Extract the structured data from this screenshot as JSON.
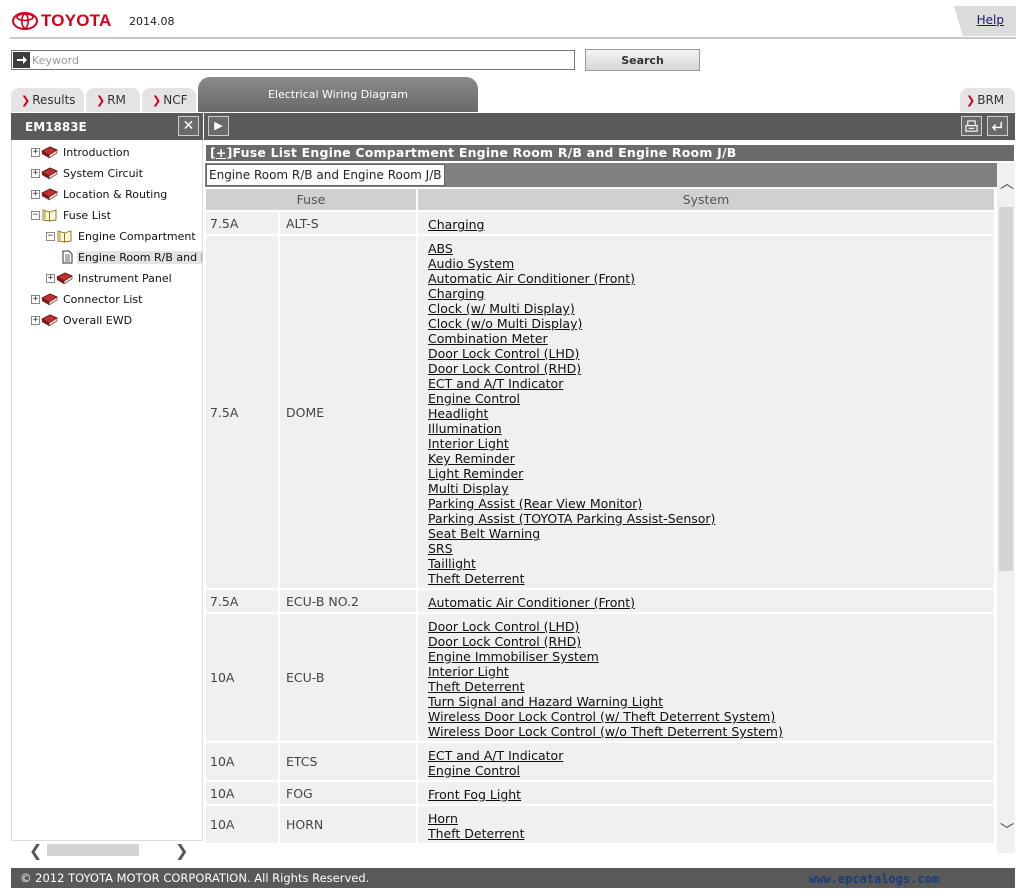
{
  "header": {
    "brand": "TOYOTA",
    "version": "2014.08",
    "help_label": "Help"
  },
  "search": {
    "placeholder": "Keyword",
    "value": "",
    "button_label": "Search"
  },
  "tabs": {
    "results": "Results",
    "rm": "RM",
    "ncf": "NCF",
    "active": "Electrical Wiring Diagram",
    "brm": "BRM"
  },
  "left_panel": {
    "code": "EM1883E",
    "tree": [
      {
        "label": "Introduction"
      },
      {
        "label": "System Circuit"
      },
      {
        "label": "Location & Routing"
      },
      {
        "label": "Fuse List"
      },
      {
        "label": "Engine Compartment"
      },
      {
        "label": "Engine Room R/B and Engine Room J/B"
      },
      {
        "label": "Instrument Panel"
      },
      {
        "label": "Connector List"
      },
      {
        "label": "Overall EWD"
      }
    ]
  },
  "content": {
    "title_prefix": "[+]",
    "title": "Fuse List  Engine Compartment  Engine Room R/B and Engine Room J/B",
    "subtitle": "Engine Room R/B and Engine Room J/B",
    "columns": [
      "Fuse",
      "System"
    ],
    "rows": [
      {
        "amp": "7.5A",
        "name": "ALT-S",
        "systems": [
          "Charging"
        ]
      },
      {
        "amp": "7.5A",
        "name": "DOME",
        "systems": [
          "ABS",
          "Audio System",
          "Automatic Air Conditioner (Front)",
          "Charging",
          "Clock (w/ Multi Display)",
          "Clock (w/o Multi Display)",
          "Combination Meter",
          "Door Lock Control (LHD)",
          "Door Lock Control (RHD)",
          "ECT and A/T Indicator",
          "Engine Control",
          "Headlight",
          "Illumination",
          "Interior Light",
          "Key Reminder",
          "Light Reminder",
          "Multi Display",
          "Parking Assist (Rear View Monitor)",
          "Parking Assist (TOYOTA Parking Assist-Sensor)",
          "Seat Belt Warning",
          "SRS",
          "Taillight",
          "Theft Deterrent"
        ]
      },
      {
        "amp": "7.5A",
        "name": "ECU-B NO.2",
        "systems": [
          "Automatic Air Conditioner (Front)"
        ]
      },
      {
        "amp": "10A",
        "name": "ECU-B",
        "systems": [
          "Door Lock Control (LHD)",
          "Door Lock Control (RHD)",
          "Engine Immobiliser System",
          "Interior Light",
          "Theft Deterrent",
          "Turn Signal and Hazard Warning Light",
          "Wireless Door Lock Control (w/ Theft Deterrent System)",
          "Wireless Door Lock Control (w/o Theft Deterrent System)"
        ]
      },
      {
        "amp": "10A",
        "name": "ETCS",
        "systems": [
          "ECT and A/T Indicator",
          "Engine Control"
        ]
      },
      {
        "amp": "10A",
        "name": "FOG",
        "systems": [
          "Front Fog Light"
        ]
      },
      {
        "amp": "10A",
        "name": "HORN",
        "systems": [
          "Horn",
          "Theft Deterrent"
        ]
      }
    ]
  },
  "footer": {
    "copyright": "© 2012 TOYOTA MOTOR CORPORATION. All Rights Reserved.",
    "watermark": "www.epcatalogs.com"
  },
  "colors": {
    "brand_red": "#d3011c",
    "dark_bar": "#5a5a5a",
    "row_bg": "#f0f0f0",
    "header_bg": "#d0d0d0"
  }
}
